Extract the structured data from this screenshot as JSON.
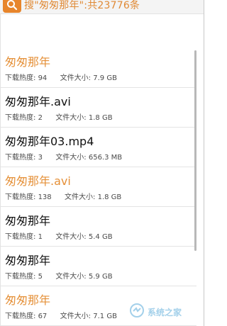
{
  "header": {
    "title": "搜\"匆匆那年\":共23776条"
  },
  "list": {
    "items": [
      {
        "title": "匆匆那年",
        "downloads_label": "下载热度:",
        "downloads": "94",
        "size_label": "文件大小:",
        "size": "7.9 GB",
        "highlight": true
      },
      {
        "title": "匆匆那年.avi",
        "downloads_label": "下载热度:",
        "downloads": "2",
        "size_label": "文件大小:",
        "size": "1.8 GB",
        "highlight": false
      },
      {
        "title": "匆匆那年03.mp4",
        "downloads_label": "下载热度:",
        "downloads": "3",
        "size_label": "文件大小:",
        "size": "656.3 MB",
        "highlight": false
      },
      {
        "title": "匆匆那年.avi",
        "downloads_label": "下载热度:",
        "downloads": "138",
        "size_label": "文件大小:",
        "size": "1.8 GB",
        "highlight": true
      },
      {
        "title": "匆匆那年",
        "downloads_label": "下载热度:",
        "downloads": "1",
        "size_label": "文件大小:",
        "size": "5.4 GB",
        "highlight": false
      },
      {
        "title": "匆匆那年",
        "downloads_label": "下载热度:",
        "downloads": "5",
        "size_label": "文件大小:",
        "size": "5.9 GB",
        "highlight": false
      },
      {
        "title": "匆匆那年",
        "downloads_label": "下载热度:",
        "downloads": "67",
        "size_label": "文件大小:",
        "size": "7.1 GB",
        "highlight": true
      }
    ]
  },
  "watermark": {
    "text": "系统之家"
  },
  "colors": {
    "accent": "#e7852c",
    "title": "#111111",
    "meta": "#4a4a4a"
  }
}
